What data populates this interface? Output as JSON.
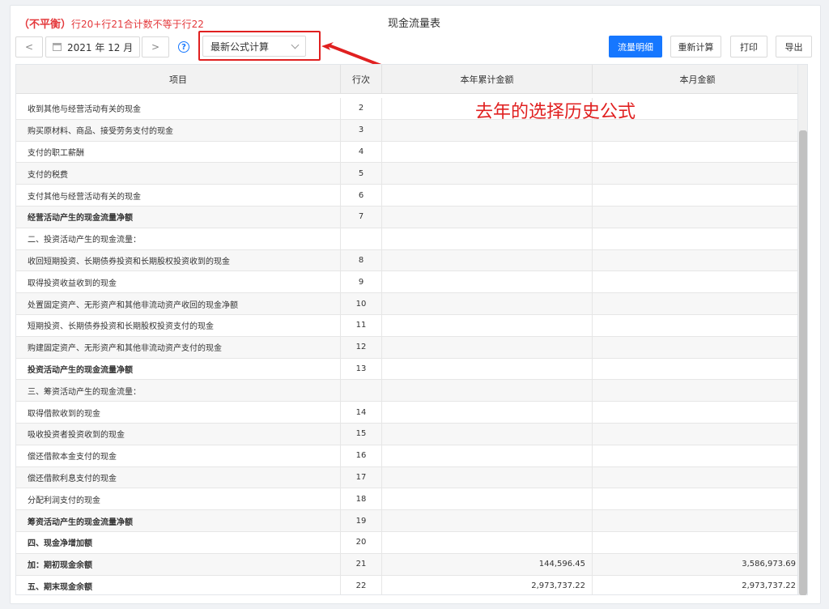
{
  "header": {
    "warning_tag": "（不平衡）",
    "warning_text": "行20+行21合计数不等于行22",
    "title": "现金流量表"
  },
  "toolbar": {
    "prev": "<",
    "next": ">",
    "period": "2021 年 12 月",
    "help": "?",
    "formula_select": "最新公式计算",
    "btn_flow_detail": "流量明细",
    "btn_recalc": "重新计算",
    "btn_print": "打印",
    "btn_export": "导出"
  },
  "annotation": "去年的选择历史公式",
  "colors": {
    "accent": "#1677ff",
    "alert": "#e02020"
  },
  "table": {
    "columns": {
      "item": "项目",
      "line": "行次",
      "ytd": "本年累计金额",
      "month": "本月金额"
    },
    "rows": [
      {
        "item": "收到其他与经营活动有关的现金",
        "line": "2",
        "ytd": "",
        "month": "",
        "bold": false
      },
      {
        "item": "购买原材料、商品、接受劳务支付的现金",
        "line": "3",
        "ytd": "",
        "month": "",
        "bold": false
      },
      {
        "item": "支付的职工薪酬",
        "line": "4",
        "ytd": "",
        "month": "",
        "bold": false
      },
      {
        "item": "支付的税费",
        "line": "5",
        "ytd": "",
        "month": "",
        "bold": false
      },
      {
        "item": "支付其他与经营活动有关的现金",
        "line": "6",
        "ytd": "",
        "month": "",
        "bold": false
      },
      {
        "item": "经营活动产生的现金流量净额",
        "line": "7",
        "ytd": "",
        "month": "",
        "bold": true
      },
      {
        "item": "二、投资活动产生的现金流量：",
        "line": "",
        "ytd": "",
        "month": "",
        "bold": false
      },
      {
        "item": "收回短期投资、长期债券投资和长期股权投资收到的现金",
        "line": "8",
        "ytd": "",
        "month": "",
        "bold": false
      },
      {
        "item": "取得投资收益收到的现金",
        "line": "9",
        "ytd": "",
        "month": "",
        "bold": false
      },
      {
        "item": "处置固定资产、无形资产和其他非流动资产收回的现金净额",
        "line": "10",
        "ytd": "",
        "month": "",
        "bold": false
      },
      {
        "item": "短期投资、长期债券投资和长期股权投资支付的现金",
        "line": "11",
        "ytd": "",
        "month": "",
        "bold": false
      },
      {
        "item": "购建固定资产、无形资产和其他非流动资产支付的现金",
        "line": "12",
        "ytd": "",
        "month": "",
        "bold": false
      },
      {
        "item": "投资活动产生的现金流量净额",
        "line": "13",
        "ytd": "",
        "month": "",
        "bold": true
      },
      {
        "item": "三、筹资活动产生的现金流量：",
        "line": "",
        "ytd": "",
        "month": "",
        "bold": false
      },
      {
        "item": "取得借款收到的现金",
        "line": "14",
        "ytd": "",
        "month": "",
        "bold": false
      },
      {
        "item": "吸收投资者投资收到的现金",
        "line": "15",
        "ytd": "",
        "month": "",
        "bold": false
      },
      {
        "item": "偿还借款本金支付的现金",
        "line": "16",
        "ytd": "",
        "month": "",
        "bold": false
      },
      {
        "item": "偿还借款利息支付的现金",
        "line": "17",
        "ytd": "",
        "month": "",
        "bold": false
      },
      {
        "item": "分配利润支付的现金",
        "line": "18",
        "ytd": "",
        "month": "",
        "bold": false
      },
      {
        "item": "筹资活动产生的现金流量净额",
        "line": "19",
        "ytd": "",
        "month": "",
        "bold": true
      },
      {
        "item": "四、现金净增加额",
        "line": "20",
        "ytd": "",
        "month": "",
        "bold": true
      },
      {
        "item": "加：期初现金余额",
        "line": "21",
        "ytd": "144,596.45",
        "month": "3,586,973.69",
        "bold": true
      },
      {
        "item": "五、期末现金余额",
        "line": "22",
        "ytd": "2,973,737.22",
        "month": "2,973,737.22",
        "bold": true
      }
    ]
  }
}
